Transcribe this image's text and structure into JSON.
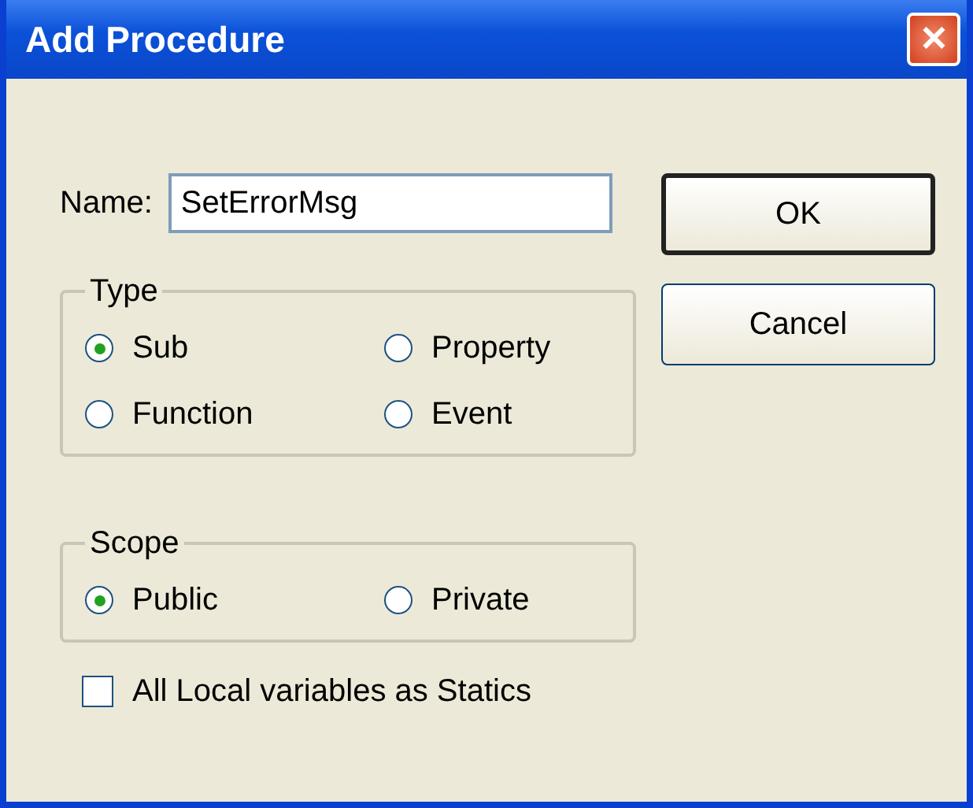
{
  "window": {
    "title": "Add Procedure",
    "close_glyph": "✕"
  },
  "name_field": {
    "label": "Name:",
    "value": "SetErrorMsg"
  },
  "type_group": {
    "label": "Type",
    "options": [
      {
        "label": "Sub",
        "selected": true
      },
      {
        "label": "Property",
        "selected": false
      },
      {
        "label": "Function",
        "selected": false
      },
      {
        "label": "Event",
        "selected": false
      }
    ]
  },
  "scope_group": {
    "label": "Scope",
    "options": [
      {
        "label": "Public",
        "selected": true
      },
      {
        "label": "Private",
        "selected": false
      }
    ]
  },
  "statics_checkbox": {
    "label": "All Local variables as Statics",
    "checked": false
  },
  "buttons": [
    {
      "label": "OK",
      "default": true
    },
    {
      "label": "Cancel",
      "default": false
    }
  ]
}
